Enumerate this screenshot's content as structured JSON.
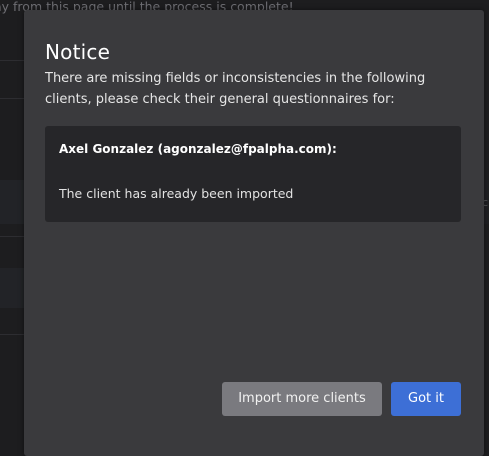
{
  "background": {
    "banner_text": "ay from this page until the process is complete!",
    "right_edge_char": "c"
  },
  "modal": {
    "title": "Notice",
    "description": "There are missing fields or inconsistencies in the following clients, please check their general questionnaires for:",
    "issues": [
      {
        "client": "Axel Gonzalez (agonzalez@fpalpha.com):",
        "message": "The client has already been imported"
      }
    ],
    "buttons": {
      "import_more_label": "Import more clients",
      "got_it_label": "Got it"
    }
  },
  "colors": {
    "modal_background": "#3a3a3d",
    "card_background": "#262629",
    "primary_button": "#3d6fd6",
    "secondary_button": "#7a7a7f"
  }
}
